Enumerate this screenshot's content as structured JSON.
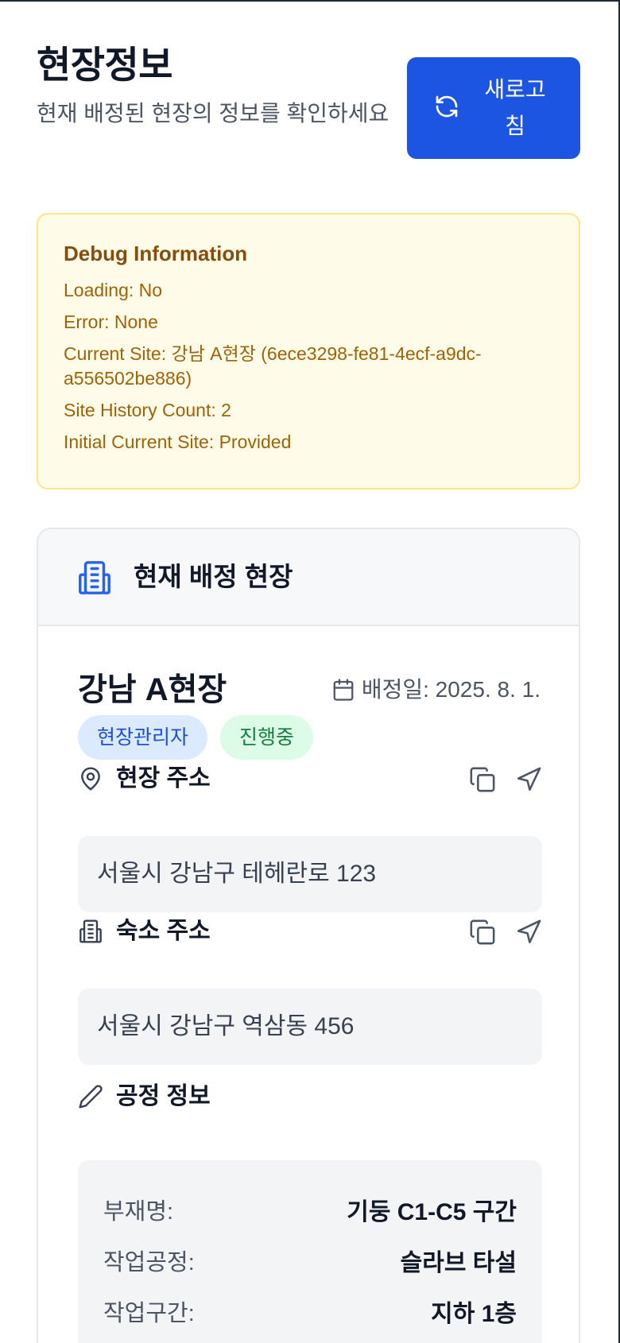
{
  "header": {
    "title": "현장정보",
    "subtitle": "현재 배정된 현장의 정보를 확인하세요",
    "refresh_label": "새로고침",
    "refresh_icon": "refresh-icon"
  },
  "debug": {
    "title": "Debug Information",
    "lines": [
      "Loading: No",
      "Error: None",
      "Current Site: 강남 A현장 (6ece3298-fe81-4ecf-a9dc-a556502be886)",
      "Site History Count: 2",
      "Initial Current Site: Provided"
    ]
  },
  "card": {
    "title": "현재 배정 현장",
    "icon": "building-icon",
    "site_name": "강남 A현장",
    "assign_date": "배정일: 2025. 8. 1.",
    "badges": {
      "role": "현장관리자",
      "status": "진행중"
    },
    "site_address": {
      "label": "현장 주소",
      "value": "서울시 강남구 테헤란로 123"
    },
    "lodging_address": {
      "label": "숙소 주소",
      "value": "서울시 강남구 역삼동 456"
    },
    "process_info": {
      "label": "공정 정보",
      "rows": [
        {
          "label": "부재명:",
          "value": "기둥 C1-C5 구간"
        },
        {
          "label": "작업공정:",
          "value": "슬라브 타설"
        },
        {
          "label": "작업구간:",
          "value": "지하 1층"
        }
      ]
    }
  },
  "colors": {
    "primary": "#1d55e3",
    "debug_bg": "#fefce8",
    "debug_text": "#a16207",
    "badge_role_bg": "#dbeafe",
    "badge_status_bg": "#dcfce7"
  }
}
